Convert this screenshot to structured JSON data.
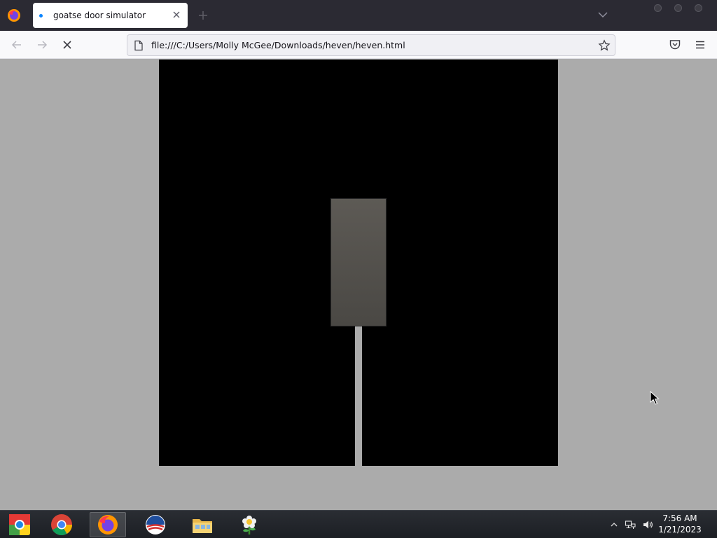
{
  "browser": {
    "tab": {
      "title": "goatse door simulator"
    },
    "url": "file:///C:/Users/Molly McGee/Downloads/heven/heven.html",
    "colors": {
      "tabstrip": "#2b2a33",
      "loading_dot": "#0a84ff"
    }
  },
  "page": {
    "background": "#ababab",
    "door_color": "#000000",
    "center_image": {
      "icon": "image-placeholder",
      "note": ""
    }
  },
  "taskbar": {
    "items": [
      {
        "name": "chromium",
        "icon": "chromium-icon"
      },
      {
        "name": "chrome",
        "icon": "chrome-icon"
      },
      {
        "name": "firefox",
        "icon": "firefox-icon",
        "active": true
      },
      {
        "name": "obama-campaign",
        "icon": "campaign-logo-icon"
      },
      {
        "name": "file-explorer",
        "icon": "folder-icon"
      },
      {
        "name": "plants-game",
        "icon": "flower-icon"
      }
    ],
    "clock": {
      "time": "7:56 AM",
      "date": "1/21/2023"
    }
  }
}
